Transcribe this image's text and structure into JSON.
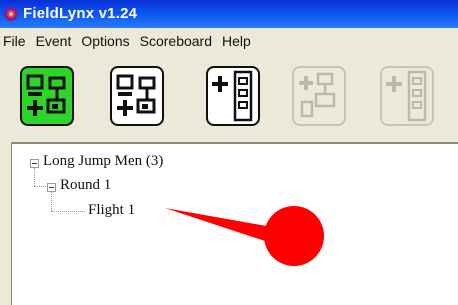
{
  "window": {
    "title": "FieldLynx  v1.24",
    "icon": "app-icon"
  },
  "menu": [
    {
      "label": "File"
    },
    {
      "label": "Event"
    },
    {
      "label": "Options"
    },
    {
      "label": "Scoreboard"
    },
    {
      "label": "Help"
    }
  ],
  "toolbar": {
    "buttons": [
      {
        "icon": "bracket-green-icon",
        "enabled": true,
        "color": "#2fd42a"
      },
      {
        "icon": "bracket-icon",
        "enabled": true
      },
      {
        "icon": "add-list-icon",
        "enabled": true
      },
      {
        "icon": "add-bracket-icon",
        "enabled": false
      },
      {
        "icon": "add-list-disabled-icon",
        "enabled": false
      }
    ]
  },
  "tree": {
    "event": "Long Jump Men  (3)",
    "round": "Round 1",
    "flight": "Flight 1"
  },
  "annotation": {
    "type": "pointer-arrow",
    "color": "#ff0000"
  }
}
